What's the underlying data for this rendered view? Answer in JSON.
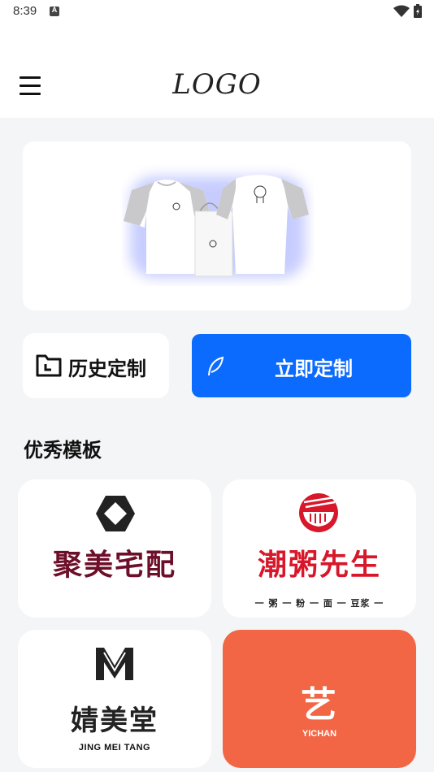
{
  "status_bar": {
    "time": "8:39",
    "notification_letter": "A"
  },
  "app_bar": {
    "logo_text": "LOGO"
  },
  "actions": {
    "history_label": "历史定制",
    "custom_label": "立即定制"
  },
  "templates": {
    "title": "优秀模板",
    "items": [
      {
        "name": "聚美宅配"
      },
      {
        "name": "潮粥先生",
        "tagline": "一 粥 一 粉 一 面 一 豆浆 一"
      },
      {
        "name": "婧美堂",
        "tagline": "JING MEI TANG"
      },
      {
        "name": "艺",
        "tagline": "YICHAN"
      }
    ]
  },
  "colors": {
    "primary": "#0b6bff",
    "page_bg": "#f4f5f7",
    "card4_bg": "#f26645",
    "card1_text": "#6e0f2a",
    "card2_text": "#d8172b"
  }
}
